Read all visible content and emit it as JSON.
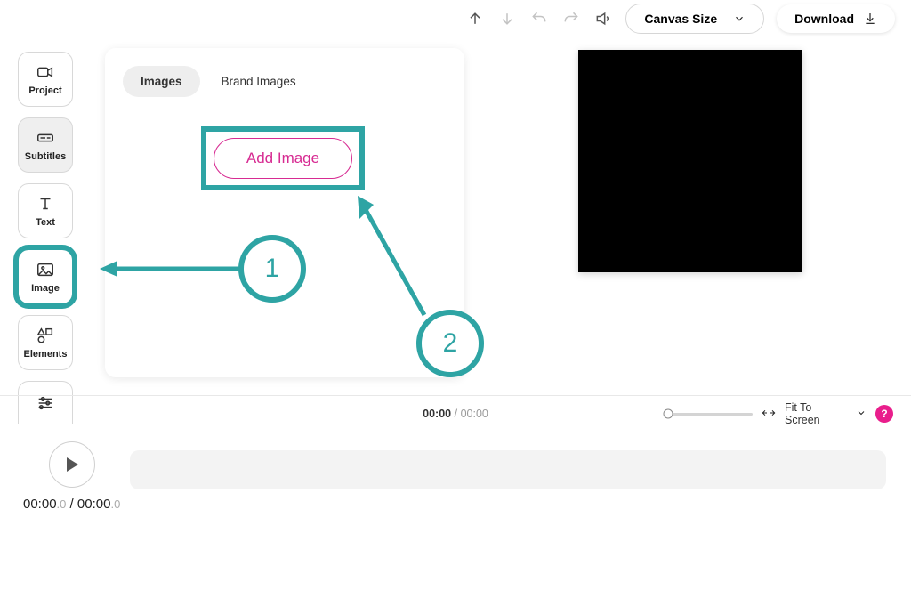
{
  "toolbar": {
    "canvas_size_label": "Canvas Size",
    "download_label": "Download"
  },
  "sidebar": {
    "items": [
      {
        "label": "Project"
      },
      {
        "label": "Subtitles"
      },
      {
        "label": "Text"
      },
      {
        "label": "Image"
      },
      {
        "label": "Elements"
      },
      {
        "label": ""
      }
    ]
  },
  "panel": {
    "tabs": [
      {
        "label": "Images"
      },
      {
        "label": "Brand Images"
      }
    ],
    "add_image_label": "Add Image"
  },
  "annotations": {
    "step1": "1",
    "step2": "2"
  },
  "midbar": {
    "current": "00:00",
    "separator": " / ",
    "total": "00:00",
    "fit_label": "Fit To Screen",
    "help": "?"
  },
  "player": {
    "current": "00:00",
    "current_dec": ".0",
    "sep": " / ",
    "total": "00:00",
    "total_dec": ".0"
  }
}
